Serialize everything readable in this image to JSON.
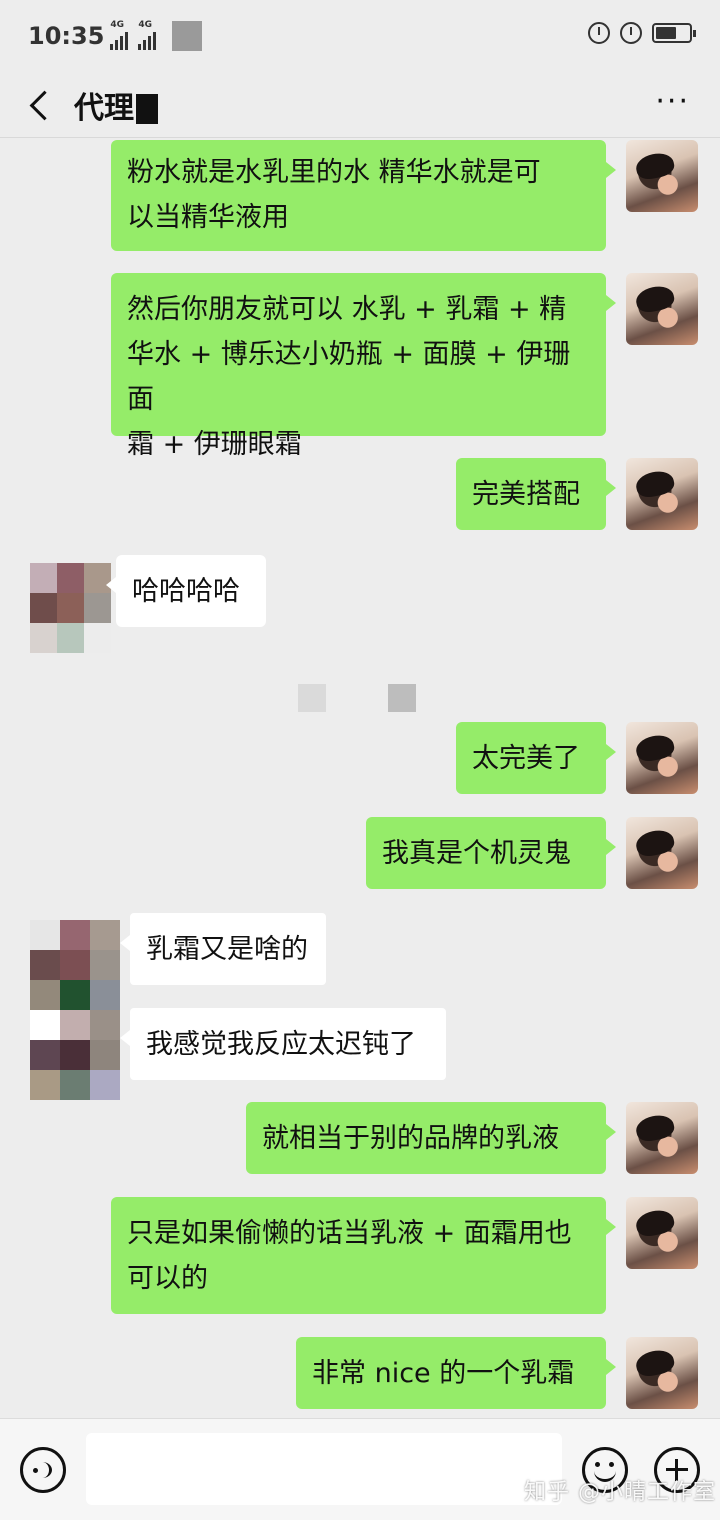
{
  "status_bar": {
    "time": "10:35",
    "signal_tag_1": "4G",
    "signal_tag_2": "4G"
  },
  "nav": {
    "title": "代理",
    "more": "···"
  },
  "messages": [
    {
      "side": "me",
      "text": "粉水就是水乳里的水 精华水就是可\n以当精华液用"
    },
    {
      "side": "me",
      "text": "然后你朋友就可以 水乳 + 乳霜 + 精\n华水 + 博乐达小奶瓶 + 面膜 + 伊珊面\n霜 + 伊珊眼霜"
    },
    {
      "side": "me",
      "text": "完美搭配"
    },
    {
      "side": "them",
      "text": "哈哈哈哈"
    },
    {
      "side": "me",
      "text": "太完美了"
    },
    {
      "side": "me",
      "text": "我真是个机灵鬼"
    },
    {
      "side": "them",
      "text": "乳霜又是啥的"
    },
    {
      "side": "them",
      "text": "我感觉我反应太迟钝了"
    },
    {
      "side": "me",
      "text": "就相当于别的品牌的乳液"
    },
    {
      "side": "me",
      "text": "只是如果偷懒的话当乳液 + 面霜用也\n可以的"
    },
    {
      "side": "me",
      "text": "非常 nice 的一个乳霜"
    }
  ],
  "input": {
    "value": "",
    "placeholder": ""
  },
  "icons": {
    "back": "back-arrow-icon",
    "more": "more-dots-icon",
    "voice": "voice-icon",
    "emoji": "emoji-icon",
    "plus": "plus-icon"
  },
  "colors": {
    "my_bubble": "#95ec69",
    "their_bubble": "#ffffff",
    "background": "#ededed"
  },
  "watermark": "知乎 @小晴工作室"
}
